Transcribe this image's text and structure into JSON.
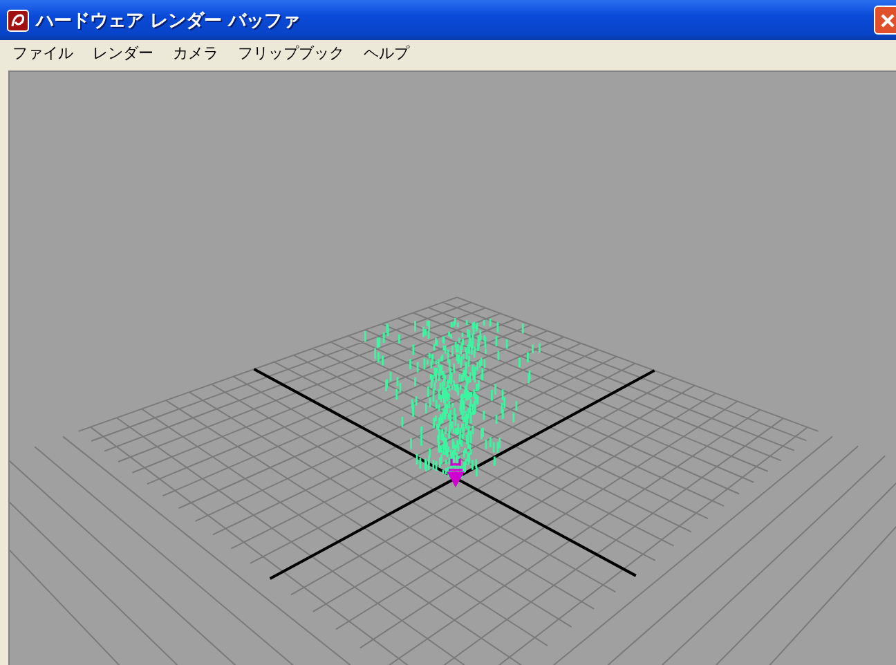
{
  "window": {
    "title": "ハードウェア レンダー バッファ"
  },
  "menu": [
    {
      "label": "ファイル"
    },
    {
      "label": "レンダー"
    },
    {
      "label": "カメラ"
    },
    {
      "label": "フリップブック"
    },
    {
      "label": "ヘルプ"
    }
  ]
}
